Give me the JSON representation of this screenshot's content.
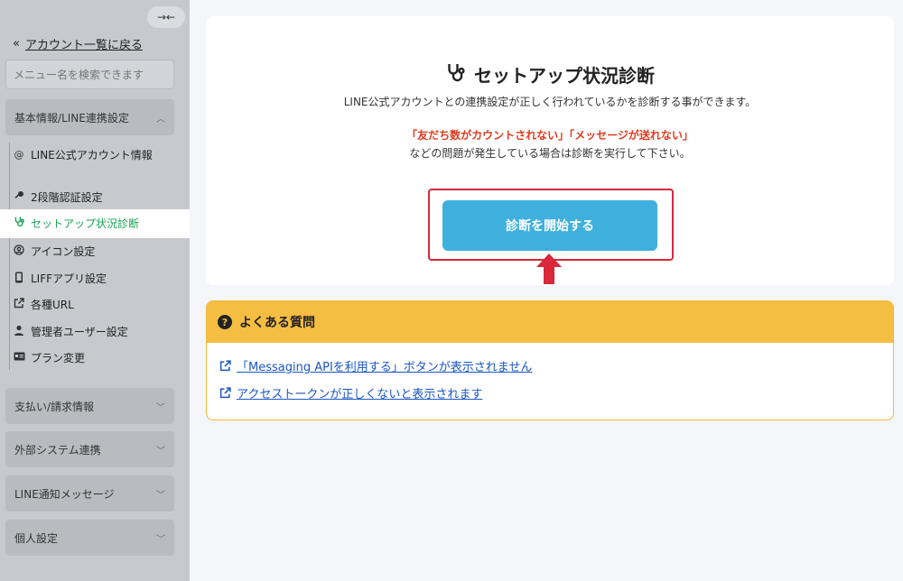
{
  "sidebar": {
    "collapse_icon": "collapse-arrows-icon",
    "back_label": "アカウント一覧に戻る",
    "search_placeholder": "メニュー名を検索できます",
    "sections": [
      {
        "label": "基本情報/LINE連携設定",
        "expanded": true
      },
      {
        "label": "支払い/請求情報",
        "expanded": false
      },
      {
        "label": "外部システム連携",
        "expanded": false
      },
      {
        "label": "LINE通知メッセージ",
        "expanded": false
      },
      {
        "label": "個人設定",
        "expanded": false
      }
    ],
    "items": [
      {
        "label": "LINE公式アカウント情報",
        "icon": "at-icon"
      },
      {
        "label": "2段階認証設定",
        "icon": "key-icon"
      },
      {
        "label": "セットアップ状況診断",
        "icon": "stethoscope-icon",
        "active": true
      },
      {
        "label": "アイコン設定",
        "icon": "user-circle-icon"
      },
      {
        "label": "LIFFアプリ設定",
        "icon": "mobile-icon"
      },
      {
        "label": "各種URL",
        "icon": "external-link-icon"
      },
      {
        "label": "管理者ユーザー設定",
        "icon": "user-icon"
      },
      {
        "label": "プラン変更",
        "icon": "id-card-icon"
      }
    ],
    "active_color": "#1aa355"
  },
  "main": {
    "title": "セットアップ状況診断",
    "description": "LINE公式アカウントとの連携設定が正しく行われているかを診断する事ができます。",
    "warning": "「友だち数がカウントされない」「メッセージが送れない」",
    "description2": "などの問題が発生している場合は診断を実行して下さい。",
    "start_button": "診断を開始する",
    "button_color": "#3fb0de",
    "highlight_color": "#d8283a"
  },
  "faq": {
    "title": "よくある質問",
    "links": [
      "「Messaging APIを利用する」ボタンが表示されません",
      "アクセストークンが正しくないと表示されます"
    ]
  }
}
